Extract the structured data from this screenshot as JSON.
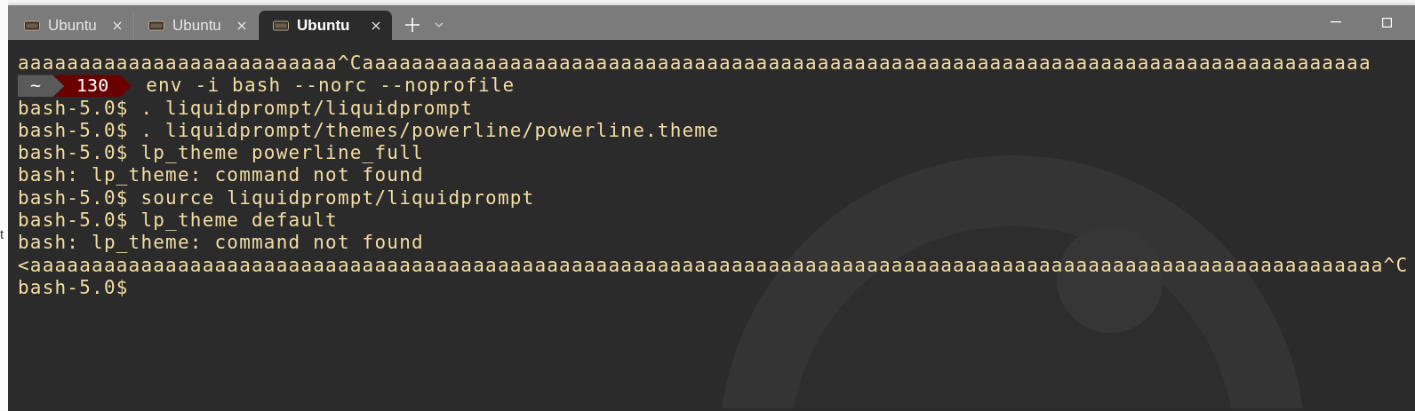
{
  "background_text": "t",
  "tabs": [
    {
      "title": "Ubuntu",
      "selected": false
    },
    {
      "title": "Ubuntu",
      "selected": false
    },
    {
      "title": "Ubuntu",
      "selected": true
    }
  ],
  "lines": [
    {
      "kind": "text",
      "text": "aaaaaaaaaaaaaaaaaaaaaaaaaa^Caaaaaaaaaaaaaaaaaaaaaaaaaaaaaaaaaaaaaaaaaaaaaaaaaaaaaaaaaaaaaaaaaaaaaaaaaaaaaaaaaa"
    },
    {
      "kind": "prompt",
      "segments": [
        {
          "text": "~",
          "color": "#5a5a5a"
        },
        {
          "text": "130",
          "color": "#6b0000"
        }
      ],
      "command": "env -i bash --norc --noprofile"
    },
    {
      "kind": "text",
      "text": "bash-5.0$ . liquidprompt/liquidprompt"
    },
    {
      "kind": "text",
      "text": "bash-5.0$ . liquidprompt/themes/powerline/powerline.theme"
    },
    {
      "kind": "text",
      "text": "bash-5.0$ lp_theme powerline_full"
    },
    {
      "kind": "text",
      "text": "bash: lp_theme: command not found"
    },
    {
      "kind": "text",
      "text": "bash-5.0$ source liquidprompt/liquidprompt"
    },
    {
      "kind": "text",
      "text": "bash-5.0$ lp_theme default"
    },
    {
      "kind": "text",
      "text": "bash: lp_theme: command not found"
    },
    {
      "kind": "text",
      "text": "<aaaaaaaaaaaaaaaaaaaaaaaaaaaaaaaaaaaaaaaaaaaaaaaaaaaaaaaaaaaaaaaaaaaaaaaaaaaaaaaaaaaaaaaaaaaaaaaaaaaaaaaaaaaaaa^C"
    },
    {
      "kind": "text",
      "text": "bash-5.0$"
    }
  ]
}
